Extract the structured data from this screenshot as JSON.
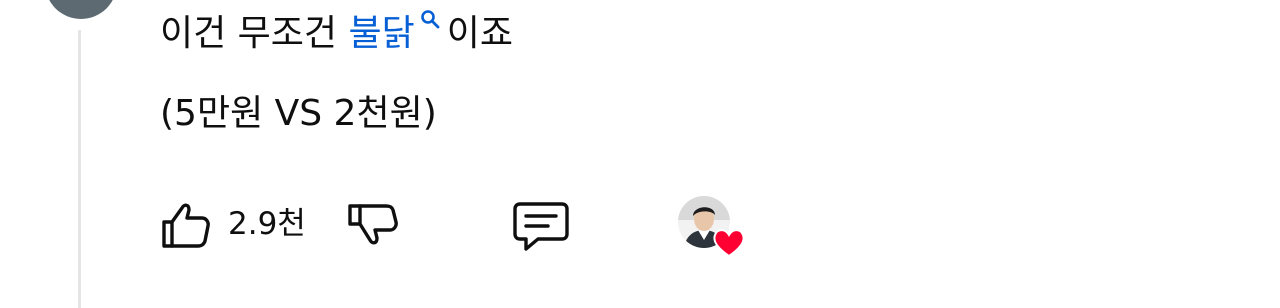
{
  "comment": {
    "line1_before": "이건 무조건 ",
    "search_link": "불닭",
    "line1_after": "이죠",
    "line2": "(5만원 VS 2천원)"
  },
  "actions": {
    "like_count": "2.9천"
  },
  "icons": {
    "like": "thumbs-up-icon",
    "dislike": "thumbs-down-icon",
    "reply": "comment-reply-icon",
    "search": "search-icon",
    "heart": "heart-icon"
  },
  "colors": {
    "link": "#065fd4",
    "heart": "#ff0033",
    "text": "#0f0f0f",
    "thread_line": "#e5e5e5"
  }
}
